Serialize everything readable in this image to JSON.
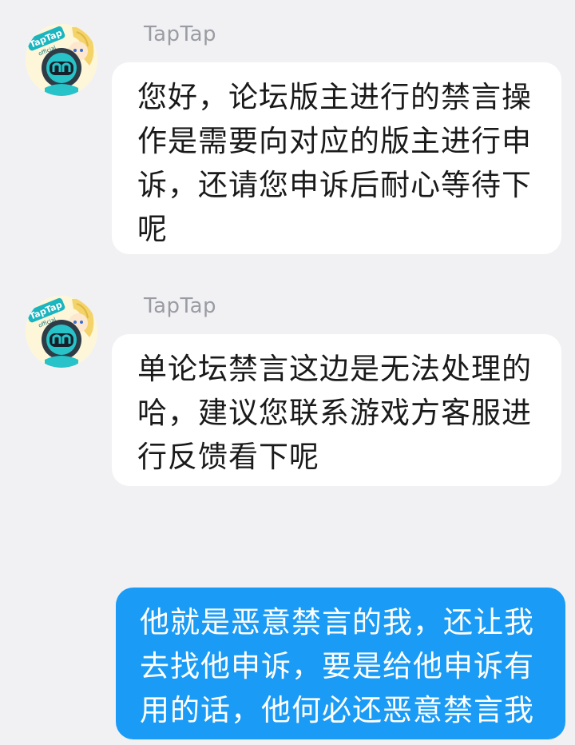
{
  "messages": [
    {
      "direction": "incoming",
      "sender": "TapTap",
      "avatar_icon": "taptap-official-avatar-icon",
      "avatar_label": "TapTap",
      "avatar_badge": "official",
      "text": "您好，论坛版主进行的禁言操作是需要向对应的版主进行申诉，还请您申诉后耐心等待下呢"
    },
    {
      "direction": "incoming",
      "sender": "TapTap",
      "avatar_icon": "taptap-official-avatar-icon",
      "avatar_label": "TapTap",
      "avatar_badge": "official",
      "text": "单论坛禁言这边是无法处理的哈，建议您联系游戏方客服进行反馈看下呢"
    },
    {
      "direction": "outgoing",
      "text": "他就是恶意禁言的我，还让我去找他申诉，要是给他申诉有用的话，他何必还恶意禁言我"
    }
  ],
  "colors": {
    "background": "#f1f1f3",
    "incoming_bubble": "#ffffff",
    "outgoing_bubble": "#1a9bf5",
    "sender_name": "#9a9ca3"
  }
}
